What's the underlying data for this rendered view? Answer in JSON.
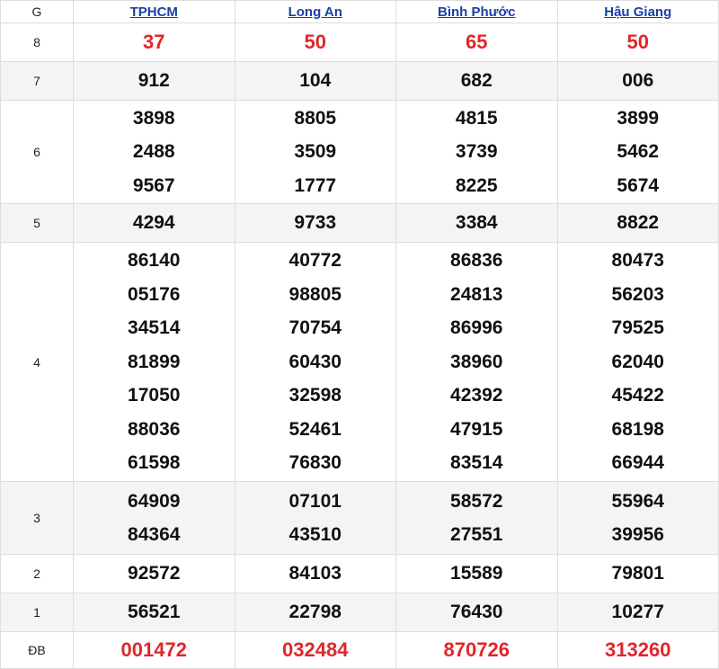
{
  "header": {
    "prize_label": "G",
    "provinces": [
      "TPHCM",
      "Long An",
      "Bình Phước",
      "Hậu Giang"
    ]
  },
  "rows": [
    {
      "label": "8",
      "highlight": true,
      "values": [
        [
          "37"
        ],
        [
          "50"
        ],
        [
          "65"
        ],
        [
          "50"
        ]
      ]
    },
    {
      "label": "7",
      "highlight": false,
      "values": [
        [
          "912"
        ],
        [
          "104"
        ],
        [
          "682"
        ],
        [
          "006"
        ]
      ]
    },
    {
      "label": "6",
      "highlight": false,
      "values": [
        [
          "3898",
          "2488",
          "9567"
        ],
        [
          "8805",
          "3509",
          "1777"
        ],
        [
          "4815",
          "3739",
          "8225"
        ],
        [
          "3899",
          "5462",
          "5674"
        ]
      ]
    },
    {
      "label": "5",
      "highlight": false,
      "values": [
        [
          "4294"
        ],
        [
          "9733"
        ],
        [
          "3384"
        ],
        [
          "8822"
        ]
      ]
    },
    {
      "label": "4",
      "highlight": false,
      "values": [
        [
          "86140",
          "05176",
          "34514",
          "81899",
          "17050",
          "88036",
          "61598"
        ],
        [
          "40772",
          "98805",
          "70754",
          "60430",
          "32598",
          "52461",
          "76830"
        ],
        [
          "86836",
          "24813",
          "86996",
          "38960",
          "42392",
          "47915",
          "83514"
        ],
        [
          "80473",
          "56203",
          "79525",
          "62040",
          "45422",
          "68198",
          "66944"
        ]
      ]
    },
    {
      "label": "3",
      "highlight": false,
      "values": [
        [
          "64909",
          "84364"
        ],
        [
          "07101",
          "43510"
        ],
        [
          "58572",
          "27551"
        ],
        [
          "55964",
          "39956"
        ]
      ]
    },
    {
      "label": "2",
      "highlight": false,
      "values": [
        [
          "92572"
        ],
        [
          "84103"
        ],
        [
          "15589"
        ],
        [
          "79801"
        ]
      ]
    },
    {
      "label": "1",
      "highlight": false,
      "values": [
        [
          "56521"
        ],
        [
          "22798"
        ],
        [
          "76430"
        ],
        [
          "10277"
        ]
      ]
    },
    {
      "label": "ĐB",
      "highlight": true,
      "values": [
        [
          "001472"
        ],
        [
          "032484"
        ],
        [
          "870726"
        ],
        [
          "313260"
        ]
      ]
    }
  ],
  "colors": {
    "highlight": "#e0262b",
    "link": "#1a3fa6",
    "alt_row": "#f4f4f4"
  }
}
